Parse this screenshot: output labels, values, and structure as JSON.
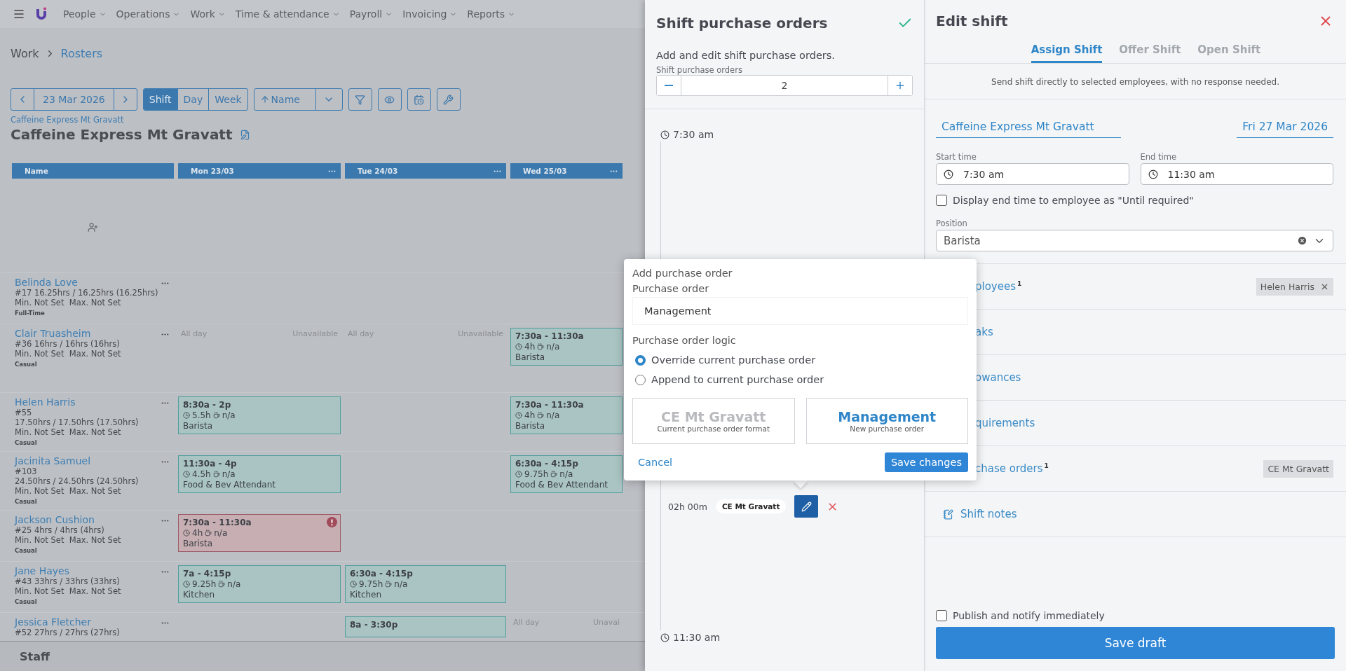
{
  "nav": {
    "items": [
      "People",
      "Operations",
      "Work",
      "Time & attendance",
      "Payroll",
      "Invoicing",
      "Reports"
    ]
  },
  "breadcrumb": [
    "Work",
    "Rosters"
  ],
  "toolbar": {
    "date": "23 Mar 2026",
    "views": [
      {
        "label": "Shift",
        "selected": true
      },
      {
        "label": "Day",
        "selected": false
      },
      {
        "label": "Week",
        "selected": false
      }
    ],
    "sort": "Name"
  },
  "location_link": "Caffeine Express Mt Gravatt",
  "title": "Caffeine Express Mt Gravatt",
  "roster": {
    "columns": [
      "Name",
      "Mon 23/03",
      "Tue 24/03",
      "Wed 25/03"
    ],
    "employees": [
      {
        "name": "Belinda Love",
        "lines": [
          "#17 16.25hrs / 16.25hrs (16.25hrs)",
          "Min. Not Set  Max. Not Set"
        ],
        "type": "Full-Time",
        "cells": [
          {
            "kind": "empty"
          },
          {
            "kind": "empty"
          },
          {
            "kind": "empty"
          }
        ]
      },
      {
        "name": "Clair Truasheim",
        "lines": [
          "#36 16hrs / 16hrs (16hrs)",
          "Min. Not Set  Max. Not Set"
        ],
        "type": "Casual",
        "cells": [
          {
            "kind": "unavailable",
            "left": "All day",
            "right": "Unavailable"
          },
          {
            "kind": "unavailable",
            "left": "All day",
            "right": "Unavailable"
          },
          {
            "kind": "shift",
            "time": "7:30a - 11:30a",
            "hours": "4h",
            "breaks": "n/a",
            "role": "Barista",
            "warning": false
          }
        ]
      },
      {
        "name": "Helen Harris",
        "lines": [
          "#55",
          "17.50hrs / 17.50hrs (17.50hrs)",
          "Min. Not Set  Max. Not Set"
        ],
        "type": "Casual",
        "cells": [
          {
            "kind": "shift",
            "time": "8:30a - 2p",
            "hours": "5.5h",
            "breaks": "n/a",
            "role": "Barista",
            "warning": false
          },
          {
            "kind": "empty"
          },
          {
            "kind": "shift",
            "time": "7:30a - 11:30a",
            "hours": "4h",
            "breaks": "n/a",
            "role": "Barista",
            "warning": false
          }
        ]
      },
      {
        "name": "Jacinita Samuel",
        "lines": [
          "#103",
          "24.50hrs / 24.50hrs (24.50hrs)",
          "Min. Not Set  Max. Not Set"
        ],
        "type": "Casual",
        "cells": [
          {
            "kind": "shift",
            "time": "11:30a - 4p",
            "hours": "4.5h",
            "breaks": "n/a",
            "role": "Food & Bev Attendant",
            "warning": false
          },
          {
            "kind": "empty"
          },
          {
            "kind": "shift",
            "time": "6:30a - 4:15p",
            "hours": "9.75h",
            "breaks": "n/a",
            "role": "Food & Bev Attendant",
            "warning": false
          }
        ]
      },
      {
        "name": "Jackson Cushion",
        "lines": [
          "#25 4hrs / 4hrs (4hrs)",
          "Min. Not Set  Max. Not Set"
        ],
        "type": "Casual",
        "cells": [
          {
            "kind": "shift",
            "time": "7:30a - 11:30a",
            "hours": "4h",
            "breaks": "n/a",
            "role": "Barista",
            "warning": true
          },
          {
            "kind": "empty"
          },
          {
            "kind": "empty"
          }
        ]
      },
      {
        "name": "Jane Hayes",
        "lines": [
          "#43 33hrs / 33hrs (33hrs)",
          "Min. Not Set  Max. Not Set"
        ],
        "type": "Casual",
        "cells": [
          {
            "kind": "shift",
            "time": "7a - 4:15p",
            "hours": "9.25h",
            "breaks": "n/a",
            "role": "Kitchen",
            "warning": false
          },
          {
            "kind": "shift",
            "time": "6:30a - 4:15p",
            "hours": "9.75h",
            "breaks": "n/a",
            "role": "Kitchen",
            "warning": false
          },
          {
            "kind": "empty"
          }
        ]
      },
      {
        "name": "Jessica Fletcher",
        "lines": [
          "#52 27hrs / 27hrs (27hrs)"
        ],
        "cells": [
          {
            "kind": "empty"
          },
          {
            "kind": "shift",
            "time": "8a - 3:30p",
            "warning": false
          },
          {
            "kind": "unavailable",
            "left": "All day",
            "right": "Unavai"
          }
        ]
      }
    ]
  },
  "footer": "Staff",
  "purchase_orders_panel": {
    "title": "Shift purchase orders",
    "description": "Add and edit shift purchase orders.",
    "stepper_label": "Shift purchase orders",
    "count": "2",
    "start": "7:30 am",
    "end": "11:30 am",
    "segment": {
      "duration": "02h 00m",
      "tag": "CE Mt Gravatt"
    }
  },
  "popover": {
    "title": "Add purchase order",
    "field_label": "Purchase order",
    "value": "Management",
    "logic_label": "Purchase order logic",
    "options": [
      {
        "label": "Override current purchase order",
        "selected": true
      },
      {
        "label": "Append to current purchase order",
        "selected": false
      }
    ],
    "formats": [
      {
        "kind": "current",
        "title": "CE Mt Gravatt",
        "caption": "Current purchase order format"
      },
      {
        "kind": "new",
        "title": "Management",
        "caption": "New purchase order"
      }
    ],
    "cancel": "Cancel",
    "save": "Save changes"
  },
  "edit_shift": {
    "title": "Edit shift",
    "tabs": [
      {
        "label": "Assign Shift",
        "selected": true
      },
      {
        "label": "Offer Shift",
        "selected": false
      },
      {
        "label": "Open Shift",
        "selected": false
      }
    ],
    "tab_description": "Send shift directly to selected employees, with no response needed.",
    "location": "Caffeine Express Mt Gravatt",
    "date": "Fri 27 Mar 2026",
    "start_label": "Start time",
    "start": "7:30 am",
    "end_label": "End time",
    "end": "11:30 am",
    "until_required": {
      "label": "Display end time to employee as \"Until required\"",
      "checked": false
    },
    "position_label": "Position",
    "position": "Barista",
    "sections": [
      {
        "label": "ployees",
        "count": "1",
        "tags": [
          {
            "label": "Helen Harris",
            "removable": true
          }
        ]
      },
      {
        "label": "aks"
      },
      {
        "label": "owances"
      },
      {
        "label": "quirements"
      },
      {
        "label": "chase orders",
        "count": "1",
        "tags": [
          {
            "label": "CE Mt Gravatt",
            "removable": false
          }
        ]
      }
    ],
    "shift_notes": "Shift notes",
    "publish": {
      "label": "Publish and notify immediately",
      "checked": false
    },
    "save": "Save draft"
  }
}
